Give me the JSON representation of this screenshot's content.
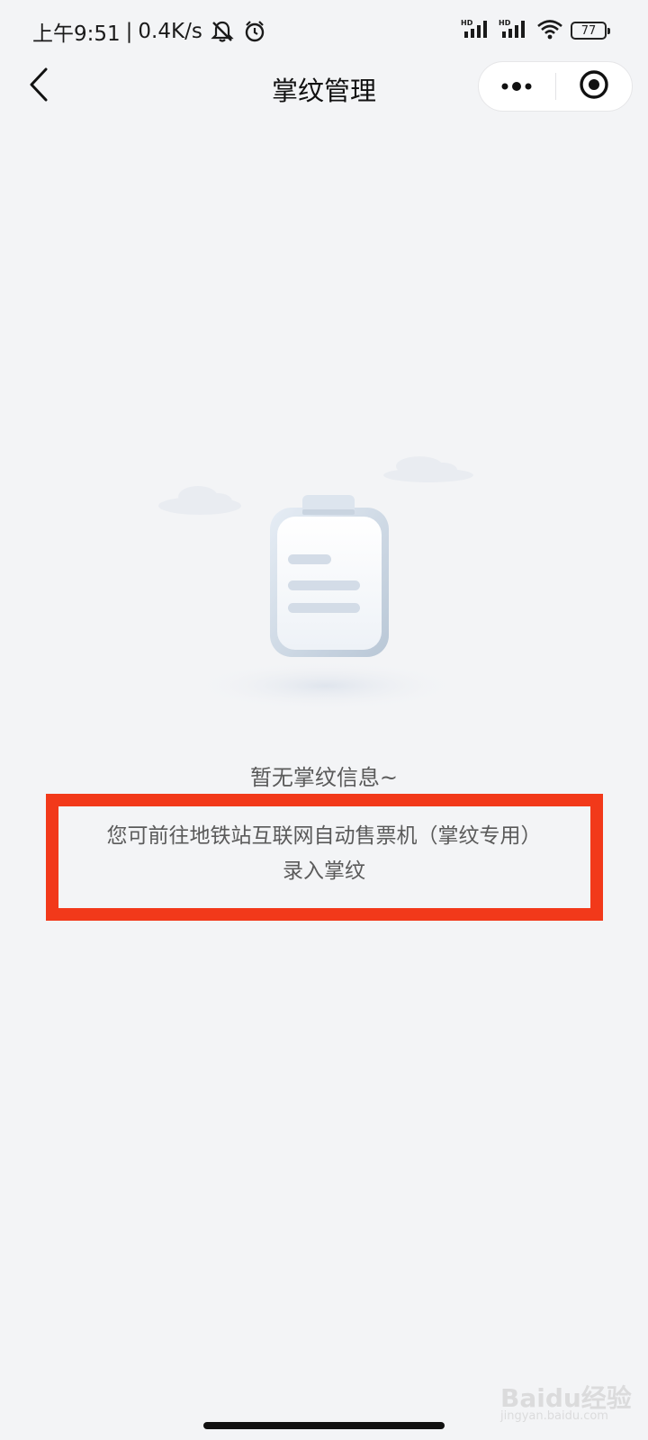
{
  "status_bar": {
    "time": "上午9:51",
    "separator": "|",
    "net_speed": "0.4K/s",
    "signal_1_label": "HD",
    "signal_2_label": "HD",
    "battery": "77",
    "icons": [
      "bell-mute-icon",
      "alarm-icon",
      "signal-icon",
      "signal-icon",
      "wifi-icon",
      "battery-icon"
    ]
  },
  "nav": {
    "title": "掌纹管理",
    "back_icon": "chevron-left-icon",
    "more_icon": "more-dots-icon",
    "close_icon": "target-icon"
  },
  "empty_state": {
    "illustration_icon": "clipboard-icon",
    "title": "暂无掌纹信息~",
    "hint_line_1": "您可前往地铁站互联网自动售票机（掌纹专用）",
    "hint_line_2": "录入掌纹",
    "highlight_color": "#f2391a"
  },
  "watermark": {
    "text": "Baidu经验",
    "sub": "jingyan.baidu.com"
  }
}
